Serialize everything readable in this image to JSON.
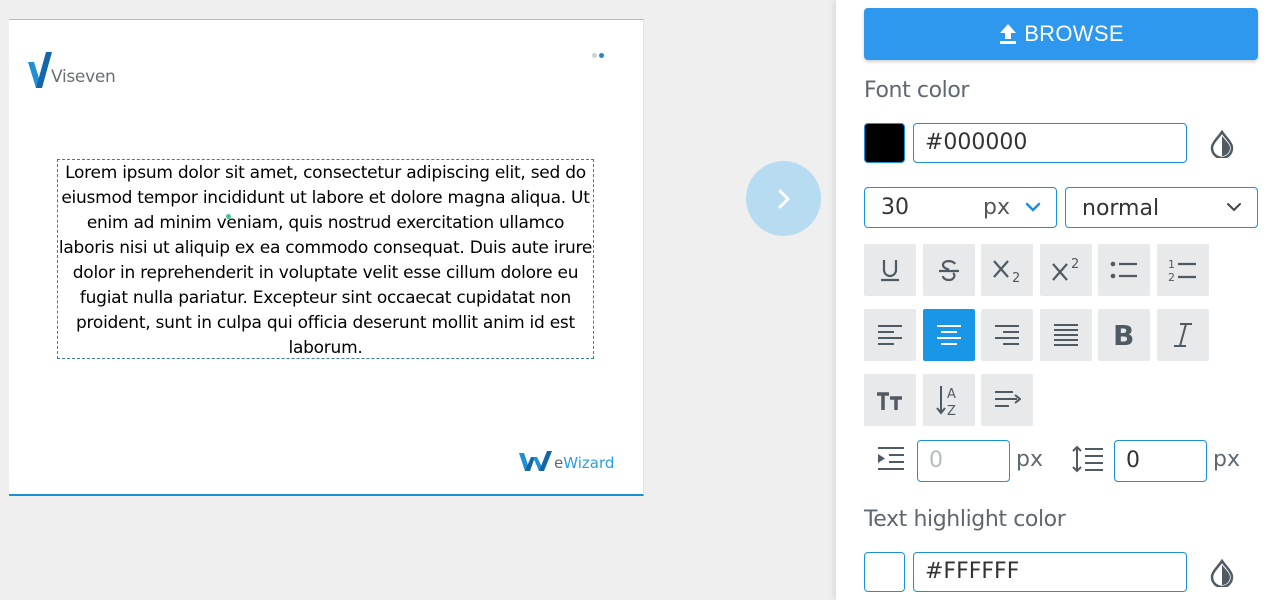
{
  "slide": {
    "logo_text": "Viseven",
    "body_text": "Lorem ipsum dolor sit amet, consectetur adipiscing elit, sed do eiusmod tempor incididunt ut labore et dolore magna aliqua. Ut enim ad minim veniam, quis nostrud exercitation ullamco laboris nisi ut aliquip ex ea commodo consequat. Duis aute irure dolor in reprehenderit in voluptate velit esse cillum dolore eu fugiat nulla pariatur. Excepteur sint occaecat cupidatat non proident, sunt in culpa qui officia deserunt mollit anim id est laborum.",
    "footer_logo_prefix": "e",
    "footer_logo_word": "Wizard"
  },
  "panel": {
    "browse_label": "BROWSE",
    "font_color": {
      "label": "Font color",
      "swatch": "#000000",
      "value": "#000000"
    },
    "font_size": {
      "value": "30",
      "unit": "px"
    },
    "font_weight": {
      "value": "normal"
    },
    "indent": {
      "placeholder": "0",
      "unit": "px"
    },
    "line_height": {
      "value": "0",
      "unit": "px"
    },
    "highlight_color": {
      "label": "Text highlight color",
      "swatch": "#FFFFFF",
      "value": "#FFFFFF"
    },
    "tools": [
      "underline-icon",
      "strikethrough-icon",
      "subscript-icon",
      "superscript-icon",
      "bullet-list-icon",
      "numbered-list-icon",
      "align-left-icon",
      "align-center-icon",
      "align-right-icon",
      "align-justify-icon",
      "bold-icon",
      "italic-icon",
      "text-transform-icon",
      "sort-az-icon",
      "text-wrap-icon"
    ],
    "active_tool": "align-center-icon",
    "accent": "#1996e6"
  }
}
